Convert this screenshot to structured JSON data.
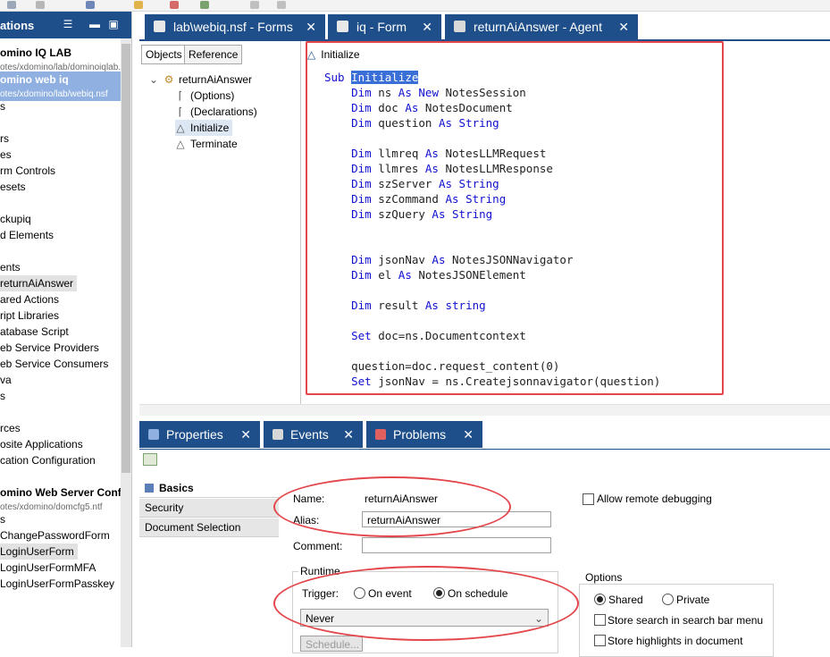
{
  "navigator": {
    "title": "ations",
    "rows": [
      {
        "text": "omino IQ LAB",
        "style": "bold"
      },
      {
        "text": "otes/xdomino/lab/dominoiqlab.nsf",
        "style": "sub"
      },
      {
        "text": "omino web iq",
        "style": "bold-selected"
      },
      {
        "text": "otes/xdomino/lab/webiq.nsf",
        "style": "sub-selected"
      },
      {
        "text": "s",
        "style": ""
      },
      {
        "text": "",
        "style": ""
      },
      {
        "text": "rs",
        "style": ""
      },
      {
        "text": "es",
        "style": ""
      },
      {
        "text": "rm Controls",
        "style": ""
      },
      {
        "text": "esets",
        "style": ""
      },
      {
        "text": "",
        "style": ""
      },
      {
        "text": "ckupiq",
        "style": ""
      },
      {
        "text": "d Elements",
        "style": ""
      },
      {
        "text": "",
        "style": ""
      },
      {
        "text": "ents",
        "style": ""
      },
      {
        "text": "returnAiAnswer",
        "style": "highlight"
      },
      {
        "text": "ared Actions",
        "style": ""
      },
      {
        "text": "ript Libraries",
        "style": ""
      },
      {
        "text": "atabase Script",
        "style": ""
      },
      {
        "text": "eb Service Providers",
        "style": ""
      },
      {
        "text": "eb Service Consumers",
        "style": ""
      },
      {
        "text": "va",
        "style": ""
      },
      {
        "text": "s",
        "style": ""
      },
      {
        "text": "",
        "style": ""
      },
      {
        "text": "rces",
        "style": ""
      },
      {
        "text": "osite Applications",
        "style": ""
      },
      {
        "text": "cation Configuration",
        "style": ""
      },
      {
        "text": "",
        "style": ""
      },
      {
        "text": "omino Web Server Configu",
        "style": "bold"
      },
      {
        "text": "otes/xdomino/domcfg5.ntf",
        "style": "sub"
      },
      {
        "text": "s",
        "style": ""
      },
      {
        "text": "ChangePasswordForm",
        "style": ""
      },
      {
        "text": "LoginUserForm",
        "style": "highlight"
      },
      {
        "text": "LoginUserFormMFA",
        "style": ""
      },
      {
        "text": "LoginUserFormPasskey",
        "style": ""
      }
    ]
  },
  "editor_tabs": [
    {
      "label": "lab\\webiq.nsf - Forms",
      "close": "✕",
      "icon": "database-icon",
      "active": true
    },
    {
      "label": "iq - Form",
      "close": "✕",
      "icon": "form-icon",
      "active": true
    },
    {
      "label": "returnAiAnswer - Agent",
      "close": "✕",
      "icon": "agent-icon",
      "active": true
    }
  ],
  "objects_pane": {
    "tab_objects": "Objects",
    "tab_reference": "Reference",
    "tree_root": "returnAiAnswer",
    "tree_items": [
      "(Options)",
      "(Declarations)",
      "Initialize",
      "Terminate"
    ]
  },
  "code_pane": {
    "header": "Initialize",
    "lines": [
      [
        {
          "t": "Sub ",
          "k": true
        },
        {
          "t": "Initialize",
          "s": true
        }
      ],
      [
        {
          "t": "    "
        },
        {
          "t": "Dim",
          "k": true
        },
        {
          "t": " ns "
        },
        {
          "t": "As",
          "k": true
        },
        {
          "t": " "
        },
        {
          "t": "New",
          "k": true
        },
        {
          "t": " NotesSession"
        }
      ],
      [
        {
          "t": "    "
        },
        {
          "t": "Dim",
          "k": true
        },
        {
          "t": " doc "
        },
        {
          "t": "As",
          "k": true
        },
        {
          "t": " NotesDocument"
        }
      ],
      [
        {
          "t": "    "
        },
        {
          "t": "Dim",
          "k": true
        },
        {
          "t": " question "
        },
        {
          "t": "As",
          "k": true
        },
        {
          "t": " "
        },
        {
          "t": "String",
          "k": true
        }
      ],
      [
        {
          "t": ""
        }
      ],
      [
        {
          "t": "    "
        },
        {
          "t": "Dim",
          "k": true
        },
        {
          "t": " llmreq "
        },
        {
          "t": "As",
          "k": true
        },
        {
          "t": " NotesLLMRequest"
        }
      ],
      [
        {
          "t": "    "
        },
        {
          "t": "Dim",
          "k": true
        },
        {
          "t": " llmres "
        },
        {
          "t": "As",
          "k": true
        },
        {
          "t": " NotesLLMResponse"
        }
      ],
      [
        {
          "t": "    "
        },
        {
          "t": "Dim",
          "k": true
        },
        {
          "t": " szServer "
        },
        {
          "t": "As",
          "k": true
        },
        {
          "t": " "
        },
        {
          "t": "String",
          "k": true
        }
      ],
      [
        {
          "t": "    "
        },
        {
          "t": "Dim",
          "k": true
        },
        {
          "t": " szCommand "
        },
        {
          "t": "As",
          "k": true
        },
        {
          "t": " "
        },
        {
          "t": "String",
          "k": true
        }
      ],
      [
        {
          "t": "    "
        },
        {
          "t": "Dim",
          "k": true
        },
        {
          "t": " szQuery "
        },
        {
          "t": "As",
          "k": true
        },
        {
          "t": " "
        },
        {
          "t": "String",
          "k": true
        }
      ],
      [
        {
          "t": ""
        }
      ],
      [
        {
          "t": ""
        }
      ],
      [
        {
          "t": "    "
        },
        {
          "t": "Dim",
          "k": true
        },
        {
          "t": " jsonNav "
        },
        {
          "t": "As",
          "k": true
        },
        {
          "t": " NotesJSONNavigator"
        }
      ],
      [
        {
          "t": "    "
        },
        {
          "t": "Dim",
          "k": true
        },
        {
          "t": " el "
        },
        {
          "t": "As",
          "k": true
        },
        {
          "t": " NotesJSONElement"
        }
      ],
      [
        {
          "t": ""
        }
      ],
      [
        {
          "t": "    "
        },
        {
          "t": "Dim",
          "k": true
        },
        {
          "t": " result "
        },
        {
          "t": "As",
          "k": true
        },
        {
          "t": " "
        },
        {
          "t": "string",
          "k": true
        }
      ],
      [
        {
          "t": ""
        }
      ],
      [
        {
          "t": "    "
        },
        {
          "t": "Set",
          "k": true
        },
        {
          "t": " doc=ns.Documentcontext"
        }
      ],
      [
        {
          "t": ""
        }
      ],
      [
        {
          "t": "    question=doc.request_content(0)"
        }
      ],
      [
        {
          "t": "    "
        },
        {
          "t": "Set",
          "k": true
        },
        {
          "t": " jsonNav = ns.Createjsonnavigator(question)"
        }
      ]
    ]
  },
  "bottom_tabs": [
    {
      "label": "Properties",
      "close": "✕",
      "icon": "properties-icon"
    },
    {
      "label": "Events",
      "close": "✕",
      "icon": "events-icon"
    },
    {
      "label": "Problems",
      "close": "✕",
      "icon": "problems-icon"
    }
  ],
  "properties": {
    "sections": [
      "Basics",
      "Security",
      "Document Selection"
    ],
    "name_label": "Name:",
    "name_value": "returnAiAnswer",
    "alias_label": "Alias:",
    "alias_value": "returnAiAnswer",
    "comment_label": "Comment:",
    "comment_value": "",
    "allow_remote_debugging": "Allow remote debugging",
    "runtime_label": "Runtime",
    "trigger_label": "Trigger:",
    "trigger_on_event": "On event",
    "trigger_on_schedule": "On schedule",
    "trigger_selected": "On schedule",
    "schedule_select": "Never",
    "schedule_button": "Schedule...",
    "options_label": "Options",
    "opt_shared": "Shared",
    "opt_private": "Private",
    "opt_selected": "Shared",
    "opt_search_bar": "Store search in search bar menu",
    "opt_highlights": "Store highlights in document"
  },
  "colors": {
    "accent": "#1e4f8a",
    "annotation_red": "#e3474c",
    "keyword": "#1010d0",
    "selection": "#3b6fd8"
  }
}
